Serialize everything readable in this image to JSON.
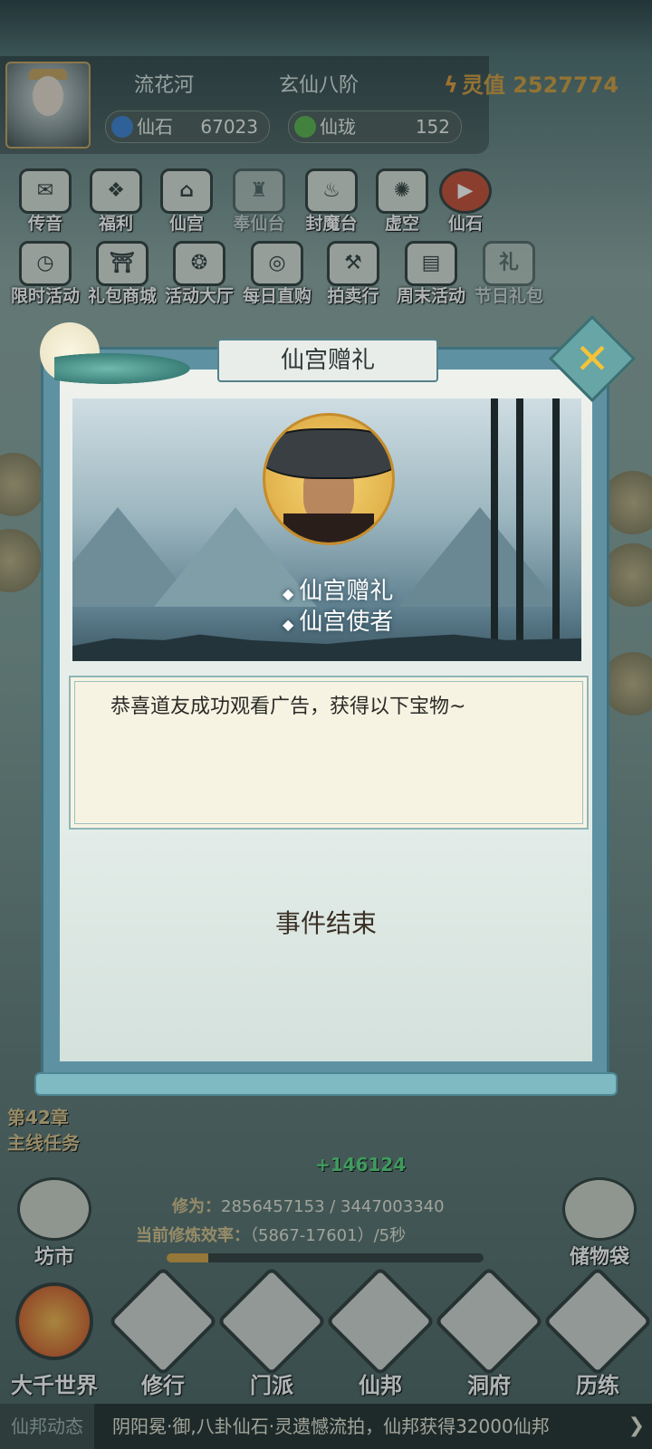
{
  "header": {
    "location": "流花河",
    "realm": "玄仙八阶",
    "lingzhi_label": "灵值",
    "lingzhi_value": "2527774",
    "resources": [
      {
        "label": "仙石",
        "value": "67023",
        "icon": "spirit-stone-icon",
        "color": "#3b7fd4"
      },
      {
        "label": "仙珑",
        "value": "152",
        "icon": "jade-icon",
        "color": "#57b24a"
      }
    ]
  },
  "menu_row1": [
    {
      "label": "传音",
      "icon": "letter-icon"
    },
    {
      "label": "福利",
      "icon": "gift-icon"
    },
    {
      "label": "仙宫",
      "icon": "palace-icon"
    },
    {
      "label": "奉仙台",
      "icon": "altar-icon"
    },
    {
      "label": "封魔台",
      "icon": "seal-icon"
    },
    {
      "label": "虚空",
      "icon": "atom-icon"
    },
    {
      "label": "仙石",
      "icon": "play-icon"
    }
  ],
  "menu_row2": [
    {
      "label": "限时活动",
      "icon": "clock-icon"
    },
    {
      "label": "礼包商城",
      "icon": "shop-icon"
    },
    {
      "label": "活动大厅",
      "icon": "hall-icon"
    },
    {
      "label": "每日直购",
      "icon": "coin-icon"
    },
    {
      "label": "拍卖行",
      "icon": "hammer-icon"
    },
    {
      "label": "周末活动",
      "icon": "card-icon"
    },
    {
      "label": "节日礼包",
      "icon": "festival-icon"
    }
  ],
  "bottom": {
    "chapter": "第42章",
    "chapter_sub": "主线任务",
    "gain": "+146124",
    "xiuwei_label": "修为：",
    "xiuwei_value": "2856457153 / 3447003340",
    "rate_label": "当前修炼效率：",
    "rate_value": "（5867-17601）/5秒",
    "progress": 0.13,
    "left_btn": "坊市",
    "right_btn": "储物袋"
  },
  "nav": [
    {
      "label": "大千世界",
      "icon": "world-icon"
    },
    {
      "label": "修行",
      "icon": "taiji-icon"
    },
    {
      "label": "门派",
      "icon": "sect-icon"
    },
    {
      "label": "仙邦",
      "icon": "shield-icon"
    },
    {
      "label": "洞府",
      "icon": "cave-icon"
    },
    {
      "label": "历练",
      "icon": "sword-icon"
    }
  ],
  "ticker": {
    "label": "仙邦动态",
    "text": "阴阳冕·御,八卦仙石·灵遗憾流拍，仙邦获得32000仙邦"
  },
  "modal": {
    "title": "仙宫赠礼",
    "banner_line1": "仙宫赠礼",
    "banner_line2": "仙宫使者",
    "message": "恭喜道友成功观看广告，获得以下宝物~",
    "end_text": "事件结束"
  }
}
